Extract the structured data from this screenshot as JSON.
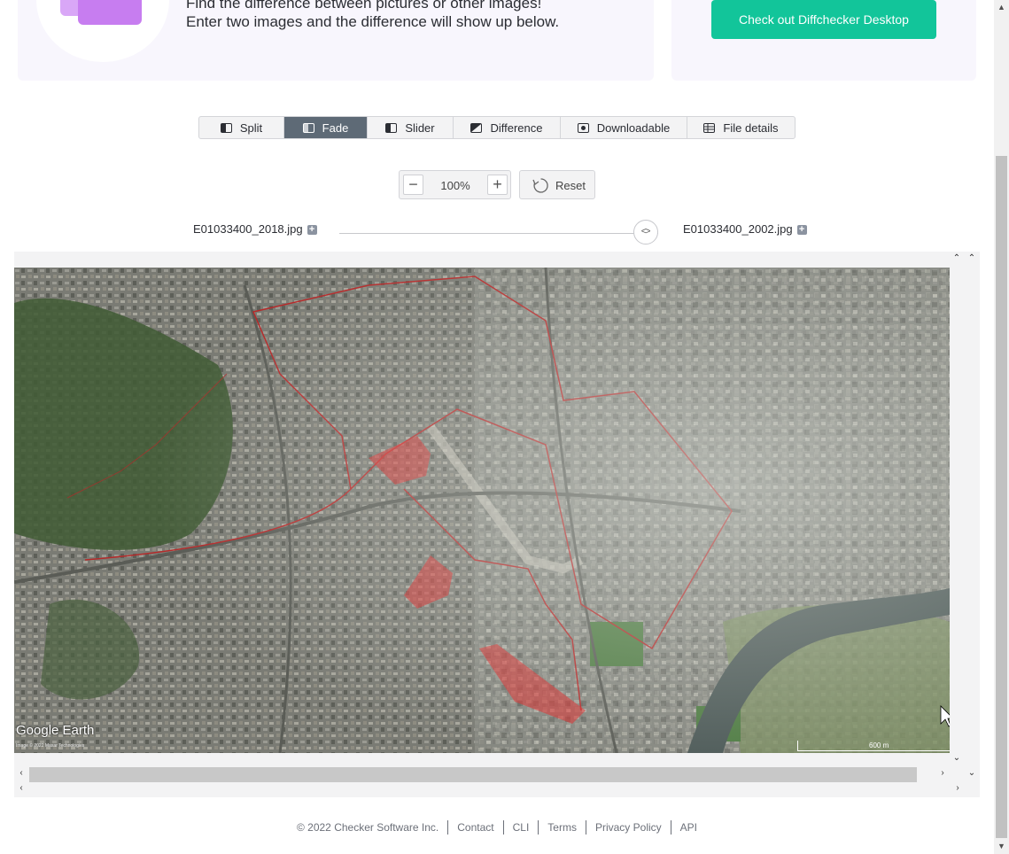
{
  "hero": {
    "line1": "Find the difference between pictures or other images!",
    "line2": "Enter two images and the difference will show up below."
  },
  "promo": {
    "button_label": "Check out Diffchecker Desktop"
  },
  "tabs": [
    {
      "label": "Split",
      "icon": "split-icon",
      "active": false
    },
    {
      "label": "Fade",
      "icon": "fade-icon",
      "active": true
    },
    {
      "label": "Slider",
      "icon": "slider-icon",
      "active": false
    },
    {
      "label": "Difference",
      "icon": "difference-icon",
      "active": false
    },
    {
      "label": "Downloadable",
      "icon": "download-icon",
      "active": false
    },
    {
      "label": "File details",
      "icon": "file-details-icon",
      "active": false
    }
  ],
  "zoom": {
    "minus": "−",
    "value": "100%",
    "plus": "+",
    "reset_label": "Reset"
  },
  "files": {
    "left": "E01033400_2018.jpg",
    "right": "E01033400_2002.jpg"
  },
  "fade": {
    "slider_position": 0.96
  },
  "map": {
    "watermark": "Google Earth",
    "credit": "Image © 2022 Maxar Technologies",
    "scale_label": "600 m"
  },
  "footer": {
    "copyright": "© 2022 Checker Software Inc.",
    "links": [
      "Contact",
      "CLI",
      "Terms",
      "Privacy Policy",
      "API"
    ]
  },
  "colors": {
    "accent": "#12c59a",
    "active_tab": "#5e6a76",
    "overlay_red": "#e02525"
  }
}
